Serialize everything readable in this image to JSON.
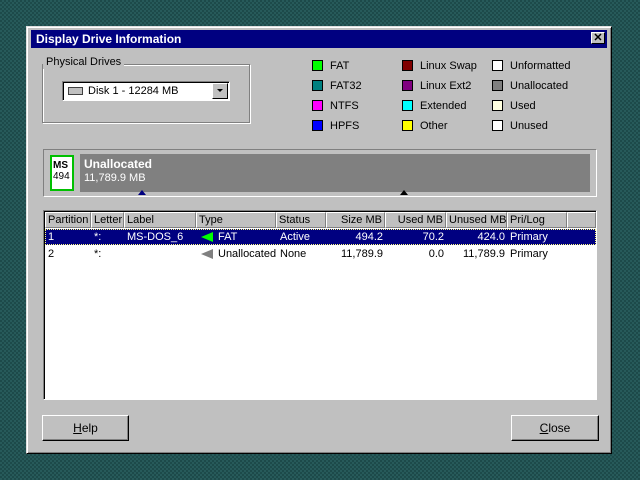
{
  "window": {
    "title": "Display Drive Information",
    "close_glyph": "✕"
  },
  "physical_drives": {
    "label": "Physical Drives",
    "selected": "Disk 1 - 12284  MB"
  },
  "legend": [
    {
      "label": "FAT",
      "color": "#00ff00"
    },
    {
      "label": "FAT32",
      "color": "#008080"
    },
    {
      "label": "NTFS",
      "color": "#ff00ff"
    },
    {
      "label": "HPFS",
      "color": "#0000ff"
    },
    {
      "label": "Linux Swap",
      "color": "#800000"
    },
    {
      "label": "Linux Ext2",
      "color": "#800080"
    },
    {
      "label": "Extended",
      "color": "#00ffff"
    },
    {
      "label": "Other",
      "color": "#ffff00"
    },
    {
      "label": "Unformatted",
      "color": "#ffffff"
    },
    {
      "label": "Unallocated",
      "color": "#808080"
    },
    {
      "label": "Used",
      "color": "#ffffe0"
    },
    {
      "label": "Unused",
      "color": "#ffffff"
    }
  ],
  "disk_map": {
    "icon_text_1": "MS",
    "icon_text_2": "494",
    "block_title": "Unallocated",
    "block_size": "11,789.9 MB"
  },
  "table": {
    "columns": [
      "Partition",
      "Letter",
      "Label",
      "Type",
      "Status",
      "Size MB",
      "Used MB",
      "Unused MB",
      "Pri/Log"
    ],
    "rows": [
      {
        "partition": "1",
        "letter": "*:",
        "label": "MS-DOS_6",
        "type": "FAT",
        "status": "Active",
        "size": "494.2",
        "used": "70.2",
        "unused": "424.0",
        "prilog": "Primary",
        "selected": true
      },
      {
        "partition": "2",
        "letter": "*:",
        "label": "",
        "type": "Unallocated",
        "status": "None",
        "size": "11,789.9",
        "used": "0.0",
        "unused": "11,789.9",
        "prilog": "Primary",
        "selected": false
      }
    ]
  },
  "buttons": {
    "help": "Help",
    "help_rest": "elp",
    "help_mnemonic": "H",
    "close": "Close",
    "close_mnemonic": "C",
    "close_rest": "lose"
  }
}
